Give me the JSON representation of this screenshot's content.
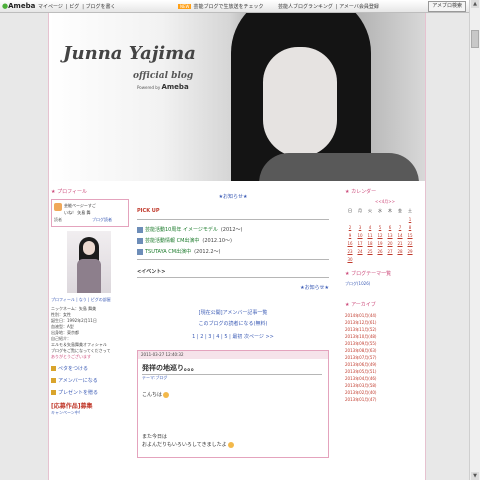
{
  "topbar": {
    "logo": "Ameba",
    "links": [
      "マイページ",
      "ピグ",
      "ブログを書く"
    ],
    "promo_badge": "NEW",
    "promo_text": "芸能ブログで生放送をチェック",
    "right_links": [
      "芸能人ブログランキング",
      "アメーバ会員登録"
    ],
    "search_label": "アメブロ検索"
  },
  "header": {
    "title": "Junna Yajima",
    "subtitle": "official blog",
    "powered_prefix": "Powered by",
    "powered_brand": "Ameba"
  },
  "left": {
    "profile_title": "プロフィール",
    "box_line1": "芸能ページーすご",
    "box_line2": "いね！  矢島 舞",
    "box_line3": "読者",
    "box_line4": "ブログ読者",
    "profile_links": "プロフィール | なう | ピグの部屋",
    "text_lines": [
      "ニックネーム：矢島 舞美",
      "性別：女性",
      "誕生日：1992年2月11日",
      "血液型：A型",
      "出身地：東京都",
      "自己紹介：",
      "エルモ＆矢島舞美オフィシャル",
      "ブログをご覧になってくださって",
      "ありがとうございます"
    ],
    "side_links": [
      "ペタをつける",
      "アメンバーになる",
      "プレゼントを贈る"
    ],
    "campaign": "[応募作品]募集",
    "campaign_sub": "キャンペーン中!"
  },
  "main": {
    "notice": "★お知らせ★",
    "pickup": "PICK UP",
    "pick_items": [
      {
        "label": "芸能活動10周年 イメージモデル",
        "date": "(2012〜)"
      },
      {
        "label": "芸能活動情報 CM出演中",
        "date": "(2012.10〜)"
      },
      {
        "label": "TSUTAYA CM出演中",
        "date": "(2012.2〜)"
      }
    ],
    "event": "<イベント>",
    "notice_right": "★お知らせ★",
    "link1": "[現在公開]アメンバー記事一覧",
    "link2": "このブログの読者になる(無料)",
    "pager": "1 | 2 | 3 | 4 | 5 | 最初 次ページ >>",
    "entry": {
      "date": "2011-03-27 12:40:32",
      "title": "発祥の地巡り。。。",
      "theme": "テーマ:ブログ",
      "line1": "こんちは",
      "line2": "また今日は",
      "line3": "およんだりもいろいろしてきましたよ"
    }
  },
  "right": {
    "calendar_title": "カレンダー",
    "month": "<<4月>>",
    "weekdays": [
      "日",
      "月",
      "火",
      "水",
      "木",
      "金",
      "土"
    ],
    "days": [
      "",
      "",
      "",
      "",
      "",
      "",
      "1",
      "2",
      "3",
      "4",
      "5",
      "6",
      "7",
      "8",
      "9",
      "10",
      "11",
      "12",
      "13",
      "14",
      "15",
      "16",
      "17",
      "18",
      "19",
      "20",
      "21",
      "22",
      "23",
      "24",
      "25",
      "26",
      "27",
      "28",
      "29",
      "30",
      "",
      "",
      "",
      "",
      "",
      ""
    ],
    "theme_title": "ブログテーマ一覧",
    "theme_link": "ブログ(1026)",
    "archive_title": "アーカイブ",
    "archives": [
      "2014年01月(44)",
      "2013年12月(61)",
      "2013年11月(52)",
      "2013年10月(48)",
      "2013年09月(55)",
      "2013年08月(63)",
      "2013年07月(57)",
      "2013年06月(49)",
      "2013年05月(51)",
      "2013年04月(46)",
      "2013年03月(58)",
      "2013年02月(40)",
      "2013年01月(47)"
    ]
  },
  "colors": {
    "accent_pink": "#cc4a7a",
    "link_blue": "#3b5bb5",
    "red": "#c0392b",
    "green": "#1a7a2a"
  }
}
